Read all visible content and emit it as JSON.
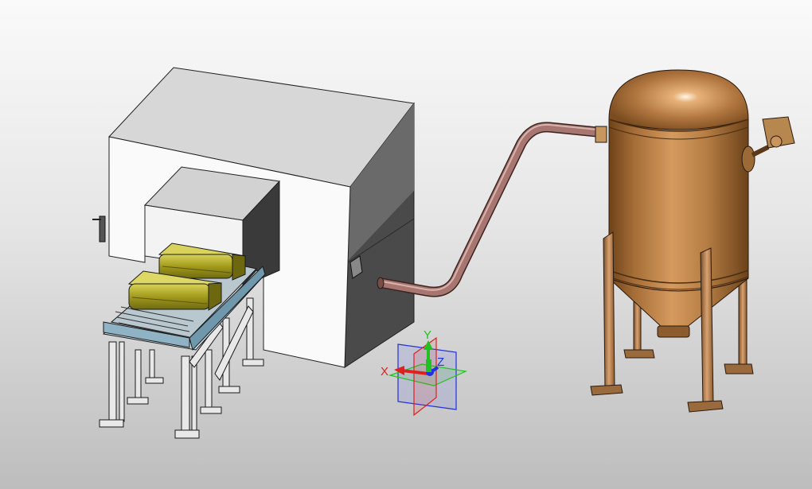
{
  "viewport": {
    "background_top": "#fafafa",
    "background_bottom": "#bdbdbd"
  },
  "model": {
    "components": [
      {
        "name": "enclosure",
        "color": "#ffffff"
      },
      {
        "name": "roller-conveyor",
        "color": "#9fb6c4"
      },
      {
        "name": "battery-modules",
        "color": "#a7a11d"
      },
      {
        "name": "transfer-pipe",
        "color": "#9a6a62"
      },
      {
        "name": "pressure-tank",
        "color": "#b0773f"
      }
    ]
  },
  "triad": {
    "x_label": "X",
    "y_label": "Y",
    "z_label": "Z",
    "x_color": "#e02020",
    "y_color": "#22c022",
    "z_color": "#2030e0",
    "icon": "coordinate-triad-icon"
  }
}
